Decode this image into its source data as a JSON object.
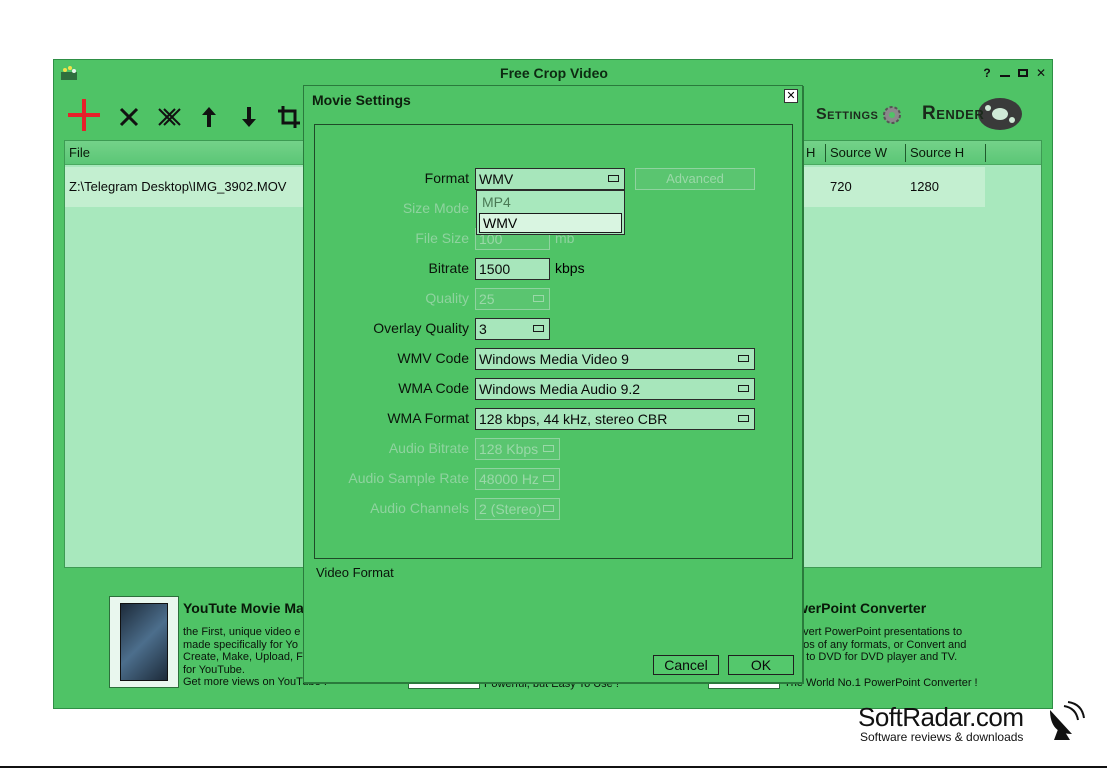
{
  "app": {
    "title": "Free Crop Video",
    "controls": {
      "help": "?",
      "minimize": "–",
      "maximize": "▫",
      "close": "✕"
    }
  },
  "toolbar": {
    "icons": [
      "add-icon",
      "remove-icon",
      "remove-all-icon",
      "move-up-icon",
      "move-down-icon",
      "crop-icon"
    ],
    "settings_label": "Settings",
    "render_label": "Render"
  },
  "file_list": {
    "columns": [
      "File",
      "H",
      "Source W",
      "Source H"
    ],
    "rows": [
      {
        "file": "Z:\\Telegram Desktop\\IMG_3902.MOV",
        "source_w": "720",
        "source_h": "1280"
      }
    ]
  },
  "ads": [
    {
      "title": "YouTute Movie Ma",
      "lines": [
        "the First, unique video e",
        "made specifically for Yo",
        "Create, Make, Upload, F",
        "for YouTube.",
        "Get more views on YouTube !"
      ]
    },
    {
      "title": "werPoint Converter",
      "lines": [
        "overt PowerPoint presentations to",
        "eos of any formats, or Convert and",
        "n to DVD for DVD player and TV.",
        "The World No.1 PowerPoint Converter !"
      ]
    },
    {
      "lines": [
        "Powerful, but Easy To Use !"
      ]
    }
  ],
  "dialog": {
    "title": "Movie Settings",
    "close": "✕",
    "fields": {
      "format": {
        "label": "Format",
        "value": "WMV"
      },
      "advanced": "Advanced",
      "format_options": [
        "MP4",
        "WMV"
      ],
      "size_mode": {
        "label": "Size Mode"
      },
      "file_size": {
        "label": "File Size",
        "value": "100",
        "unit": "mb"
      },
      "bitrate": {
        "label": "Bitrate",
        "value": "1500",
        "unit": "kbps"
      },
      "quality": {
        "label": "Quality",
        "value": "25"
      },
      "overlay_quality": {
        "label": "Overlay Quality",
        "value": "3"
      },
      "wmv_code": {
        "label": "WMV Code",
        "value": "Windows Media Video 9"
      },
      "wma_code": {
        "label": "WMA Code",
        "value": "Windows Media Audio 9.2"
      },
      "wma_format": {
        "label": "WMA Format",
        "value": "128 kbps, 44 kHz, stereo CBR"
      },
      "audio_bitrate": {
        "label": "Audio Bitrate",
        "value": "128 Kbps"
      },
      "audio_sample_rate": {
        "label": "Audio Sample Rate",
        "value": "48000 Hz"
      },
      "audio_channels": {
        "label": "Audio Channels",
        "value": "2 (Stereo)"
      }
    },
    "status": "Video Format",
    "cancel": "Cancel",
    "ok": "OK"
  },
  "watermark": {
    "title": "SoftRadar.com",
    "subtitle": "Software reviews & downloads"
  },
  "colors": {
    "window_bg": "#4fc366",
    "list_bg": "#a8e8bd",
    "row_bg": "#c3efd0",
    "add_icon": "#e8202a"
  }
}
